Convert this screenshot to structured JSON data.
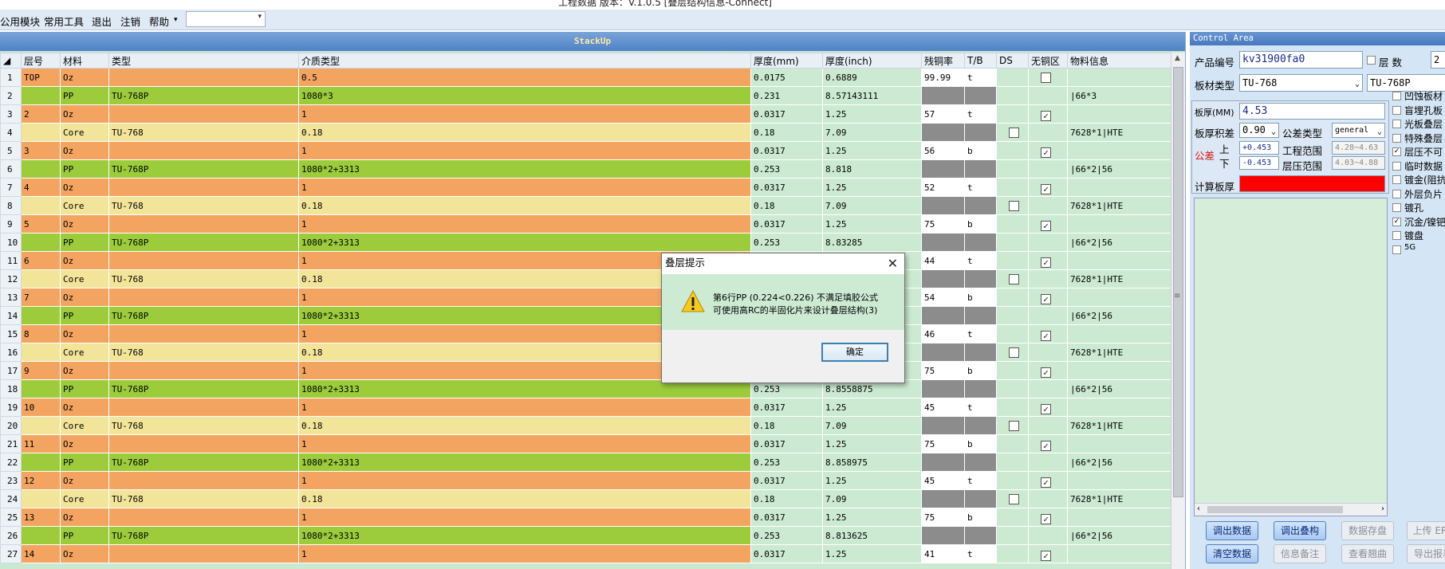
{
  "window": {
    "title": "工程数据   版本：V.1.0.5   [叠层结构信息-Connect]"
  },
  "menu": {
    "items": [
      "公用模块",
      "常用工具",
      "退出",
      "注销",
      "帮助"
    ],
    "combo_value": ""
  },
  "stack": {
    "header": "StackUp",
    "columns": [
      "层号",
      "材料",
      "类型",
      "介质类型",
      "厚度(mm)",
      "厚度(inch)",
      "残铜率",
      "T/B",
      "DS",
      "无铜区",
      "物料信息"
    ],
    "rows": [
      {
        "n": "1",
        "layer": "TOP",
        "mat": "Oz",
        "type": "",
        "diel": "0.5",
        "mm": "0.0175",
        "inch": "0.6889",
        "cu": "99.99",
        "tb": "t",
        "ds": "",
        "nocu": "empty",
        "info": "",
        "kind": "oz"
      },
      {
        "n": "2",
        "layer": "",
        "mat": "PP",
        "type": "TU-768P",
        "diel": "1080*3",
        "mm": "0.231",
        "inch": "8.57143111",
        "cu": "",
        "tb": "",
        "ds": "",
        "nocu": "",
        "info": "|66*3",
        "kind": "pp"
      },
      {
        "n": "3",
        "layer": "2",
        "mat": "Oz",
        "type": "",
        "diel": "1",
        "mm": "0.0317",
        "inch": "1.25",
        "cu": "57",
        "tb": "t",
        "ds": "",
        "nocu": "checked",
        "info": "",
        "kind": "oz"
      },
      {
        "n": "4",
        "layer": "",
        "mat": "Core",
        "type": "TU-768",
        "diel": "0.18",
        "mm": "0.18",
        "inch": "7.09",
        "cu": "",
        "tb": "",
        "ds": "empty",
        "nocu": "",
        "info": "7628*1|HTE",
        "kind": "core"
      },
      {
        "n": "5",
        "layer": "3",
        "mat": "Oz",
        "type": "",
        "diel": "1",
        "mm": "0.0317",
        "inch": "1.25",
        "cu": "56",
        "tb": "b",
        "ds": "",
        "nocu": "checked",
        "info": "",
        "kind": "oz"
      },
      {
        "n": "6",
        "layer": "",
        "mat": "PP",
        "type": "TU-768P",
        "diel": "1080*2+3313",
        "mm": "0.253",
        "inch": "8.818",
        "cu": "",
        "tb": "",
        "ds": "",
        "nocu": "",
        "info": "|66*2|56",
        "kind": "pp"
      },
      {
        "n": "7",
        "layer": "4",
        "mat": "Oz",
        "type": "",
        "diel": "1",
        "mm": "0.0317",
        "inch": "1.25",
        "cu": "52",
        "tb": "t",
        "ds": "",
        "nocu": "checked",
        "info": "",
        "kind": "oz"
      },
      {
        "n": "8",
        "layer": "",
        "mat": "Core",
        "type": "TU-768",
        "diel": "0.18",
        "mm": "0.18",
        "inch": "7.09",
        "cu": "",
        "tb": "",
        "ds": "empty",
        "nocu": "",
        "info": "7628*1|HTE",
        "kind": "core"
      },
      {
        "n": "9",
        "layer": "5",
        "mat": "Oz",
        "type": "",
        "diel": "1",
        "mm": "0.0317",
        "inch": "1.25",
        "cu": "75",
        "tb": "b",
        "ds": "",
        "nocu": "checked",
        "info": "",
        "kind": "oz"
      },
      {
        "n": "10",
        "layer": "",
        "mat": "PP",
        "type": "TU-768P",
        "diel": "1080*2+3313",
        "mm": "0.253",
        "inch": "8.83285",
        "cu": "",
        "tb": "",
        "ds": "",
        "nocu": "",
        "info": "|66*2|56",
        "kind": "pp"
      },
      {
        "n": "11",
        "layer": "6",
        "mat": "Oz",
        "type": "",
        "diel": "1",
        "mm": "",
        "inch": "",
        "cu": "44",
        "tb": "t",
        "ds": "",
        "nocu": "checked",
        "info": "",
        "kind": "oz"
      },
      {
        "n": "12",
        "layer": "",
        "mat": "Core",
        "type": "TU-768",
        "diel": "0.18",
        "mm": "",
        "inch": "",
        "cu": "",
        "tb": "",
        "ds": "empty",
        "nocu": "",
        "info": "7628*1|HTE",
        "kind": "core"
      },
      {
        "n": "13",
        "layer": "7",
        "mat": "Oz",
        "type": "",
        "diel": "1",
        "mm": "",
        "inch": "",
        "cu": "54",
        "tb": "b",
        "ds": "",
        "nocu": "checked",
        "info": "",
        "kind": "oz"
      },
      {
        "n": "14",
        "layer": "",
        "mat": "PP",
        "type": "TU-768P",
        "diel": "1080*2+3313",
        "mm": "",
        "inch": "",
        "cu": "",
        "tb": "",
        "ds": "",
        "nocu": "",
        "info": "|66*2|56",
        "kind": "pp"
      },
      {
        "n": "15",
        "layer": "8",
        "mat": "Oz",
        "type": "",
        "diel": "1",
        "mm": "",
        "inch": "",
        "cu": "46",
        "tb": "t",
        "ds": "",
        "nocu": "checked",
        "info": "",
        "kind": "oz"
      },
      {
        "n": "16",
        "layer": "",
        "mat": "Core",
        "type": "TU-768",
        "diel": "0.18",
        "mm": "",
        "inch": "",
        "cu": "",
        "tb": "",
        "ds": "empty",
        "nocu": "",
        "info": "7628*1|HTE",
        "kind": "core"
      },
      {
        "n": "17",
        "layer": "9",
        "mat": "Oz",
        "type": "",
        "diel": "1",
        "mm": "",
        "inch": "",
        "cu": "75",
        "tb": "b",
        "ds": "",
        "nocu": "checked",
        "info": "",
        "kind": "oz"
      },
      {
        "n": "18",
        "layer": "",
        "mat": "PP",
        "type": "TU-768P",
        "diel": "1080*2+3313",
        "mm": "0.253",
        "inch": "8.8558875",
        "cu": "",
        "tb": "",
        "ds": "",
        "nocu": "",
        "info": "|66*2|56",
        "kind": "pp"
      },
      {
        "n": "19",
        "layer": "10",
        "mat": "Oz",
        "type": "",
        "diel": "1",
        "mm": "0.0317",
        "inch": "1.25",
        "cu": "45",
        "tb": "t",
        "ds": "",
        "nocu": "checked",
        "info": "",
        "kind": "oz"
      },
      {
        "n": "20",
        "layer": "",
        "mat": "Core",
        "type": "TU-768",
        "diel": "0.18",
        "mm": "0.18",
        "inch": "7.09",
        "cu": "",
        "tb": "",
        "ds": "empty",
        "nocu": "",
        "info": "7628*1|HTE",
        "kind": "core"
      },
      {
        "n": "21",
        "layer": "11",
        "mat": "Oz",
        "type": "",
        "diel": "1",
        "mm": "0.0317",
        "inch": "1.25",
        "cu": "75",
        "tb": "b",
        "ds": "",
        "nocu": "checked",
        "info": "",
        "kind": "oz"
      },
      {
        "n": "22",
        "layer": "",
        "mat": "PP",
        "type": "TU-768P",
        "diel": "1080*2+3313",
        "mm": "0.253",
        "inch": "8.858975",
        "cu": "",
        "tb": "",
        "ds": "",
        "nocu": "",
        "info": "|66*2|56",
        "kind": "pp"
      },
      {
        "n": "23",
        "layer": "12",
        "mat": "Oz",
        "type": "",
        "diel": "1",
        "mm": "0.0317",
        "inch": "1.25",
        "cu": "45",
        "tb": "t",
        "ds": "",
        "nocu": "checked",
        "info": "",
        "kind": "oz"
      },
      {
        "n": "24",
        "layer": "",
        "mat": "Core",
        "type": "TU-768",
        "diel": "0.18",
        "mm": "0.18",
        "inch": "7.09",
        "cu": "",
        "tb": "",
        "ds": "empty",
        "nocu": "",
        "info": "7628*1|HTE",
        "kind": "core"
      },
      {
        "n": "25",
        "layer": "13",
        "mat": "Oz",
        "type": "",
        "diel": "1",
        "mm": "0.0317",
        "inch": "1.25",
        "cu": "75",
        "tb": "b",
        "ds": "",
        "nocu": "checked",
        "info": "",
        "kind": "oz"
      },
      {
        "n": "26",
        "layer": "",
        "mat": "PP",
        "type": "TU-768P",
        "diel": "1080*2+3313",
        "mm": "0.253",
        "inch": "8.813625",
        "cu": "",
        "tb": "",
        "ds": "",
        "nocu": "",
        "info": "|66*2|56",
        "kind": "pp"
      },
      {
        "n": "27",
        "layer": "14",
        "mat": "Oz",
        "type": "",
        "diel": "1",
        "mm": "0.0317",
        "inch": "1.25",
        "cu": "41",
        "tb": "t",
        "ds": "",
        "nocu": "checked",
        "info": "",
        "kind": "oz"
      }
    ]
  },
  "control": {
    "header": "Control Area",
    "product_label": "产品编号",
    "product_value": "kv31900fa0",
    "layers_label": "层 数",
    "layers_value": "2",
    "board_type_label": "板材类型",
    "board_type_value": "TU-768",
    "board_type_value2": "TU-768P",
    "thickness_label": "板厚(MM)",
    "thickness_value": "4.53",
    "tol_label": "板厚积差",
    "tol_value": "0.90",
    "tol_type_label": "公差类型",
    "tol_type_value": "general",
    "gongcha_label": "公差",
    "up_label": "上",
    "down_label": "下",
    "up_value": "+0.453",
    "down_value": "-0.453",
    "eng_range_label": "工程范围",
    "eng_range_value": "4.28~4.63",
    "press_range_label": "层压范围",
    "press_range_value": "4.03~4.88",
    "calc_label": "计算板厚",
    "calc_value": "",
    "calc_color": "#ff0000",
    "options": [
      {
        "label": "凹蚀板材",
        "checked": false
      },
      {
        "label": "盲埋孔板",
        "checked": false
      },
      {
        "label": "光板叠层",
        "checked": false
      },
      {
        "label": "特殊叠层",
        "checked": false
      },
      {
        "label": "层压不可",
        "checked": true
      },
      {
        "label": "临时数据",
        "checked": false
      },
      {
        "label": "镀金(阻抗",
        "checked": false
      },
      {
        "label": "外层负片",
        "checked": false
      },
      {
        "label": "镀孔",
        "checked": false
      },
      {
        "label": "沉金/镍钯",
        "checked": true
      },
      {
        "label": "镀盘",
        "checked": false
      },
      {
        "label": "5G",
        "checked": false
      }
    ],
    "buttons_row1": [
      "调出数据",
      "调出叠构",
      "数据存盘",
      "上传 ERP"
    ],
    "buttons_row2": [
      "清空数据",
      "信息备注",
      "查看翘曲",
      "导出报表"
    ]
  },
  "dialog": {
    "title": "叠层提示",
    "line1": "第6行PP (0.224<0.226) 不满足填胶公式",
    "line2": "可使用高RC的半固化片来设计叠层结构(3)",
    "ok": "确定"
  }
}
